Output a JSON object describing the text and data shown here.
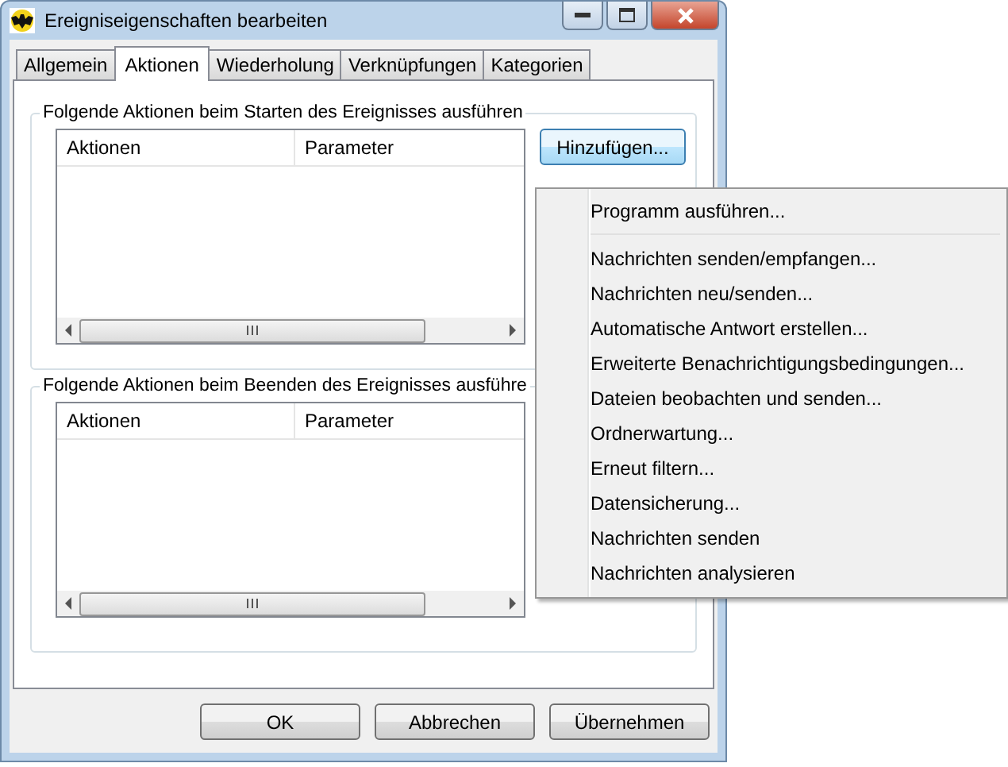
{
  "window": {
    "title": "Ereigniseigenschaften bearbeiten"
  },
  "tabs": [
    {
      "label": "Allgemein",
      "selected": false
    },
    {
      "label": "Aktionen",
      "selected": true
    },
    {
      "label": "Wiederholung",
      "selected": false
    },
    {
      "label": "Verknüpfungen",
      "selected": false
    },
    {
      "label": "Kategorien",
      "selected": false
    }
  ],
  "groups": [
    {
      "title": "Folgende Aktionen beim Starten des Ereignisses ausführen",
      "columns": [
        "Aktionen",
        "Parameter"
      ],
      "button": "Hinzufügen..."
    },
    {
      "title": "Folgende Aktionen beim Beenden des Ereignisses ausführe",
      "columns": [
        "Aktionen",
        "Parameter"
      ]
    }
  ],
  "menu": {
    "groups": [
      [
        "Programm ausführen..."
      ],
      [
        "Nachrichten senden/empfangen...",
        "Nachrichten neu/senden...",
        "Automatische Antwort erstellen...",
        "Erweiterte Benachrichtigungsbedingungen...",
        "Dateien beobachten und senden...",
        "Ordnerwartung...",
        "Erneut filtern...",
        "Datensicherung...",
        "Nachrichten senden",
        "Nachrichten analysieren"
      ]
    ]
  },
  "buttons": [
    "OK",
    "Abbrechen",
    "Übernehmen"
  ]
}
